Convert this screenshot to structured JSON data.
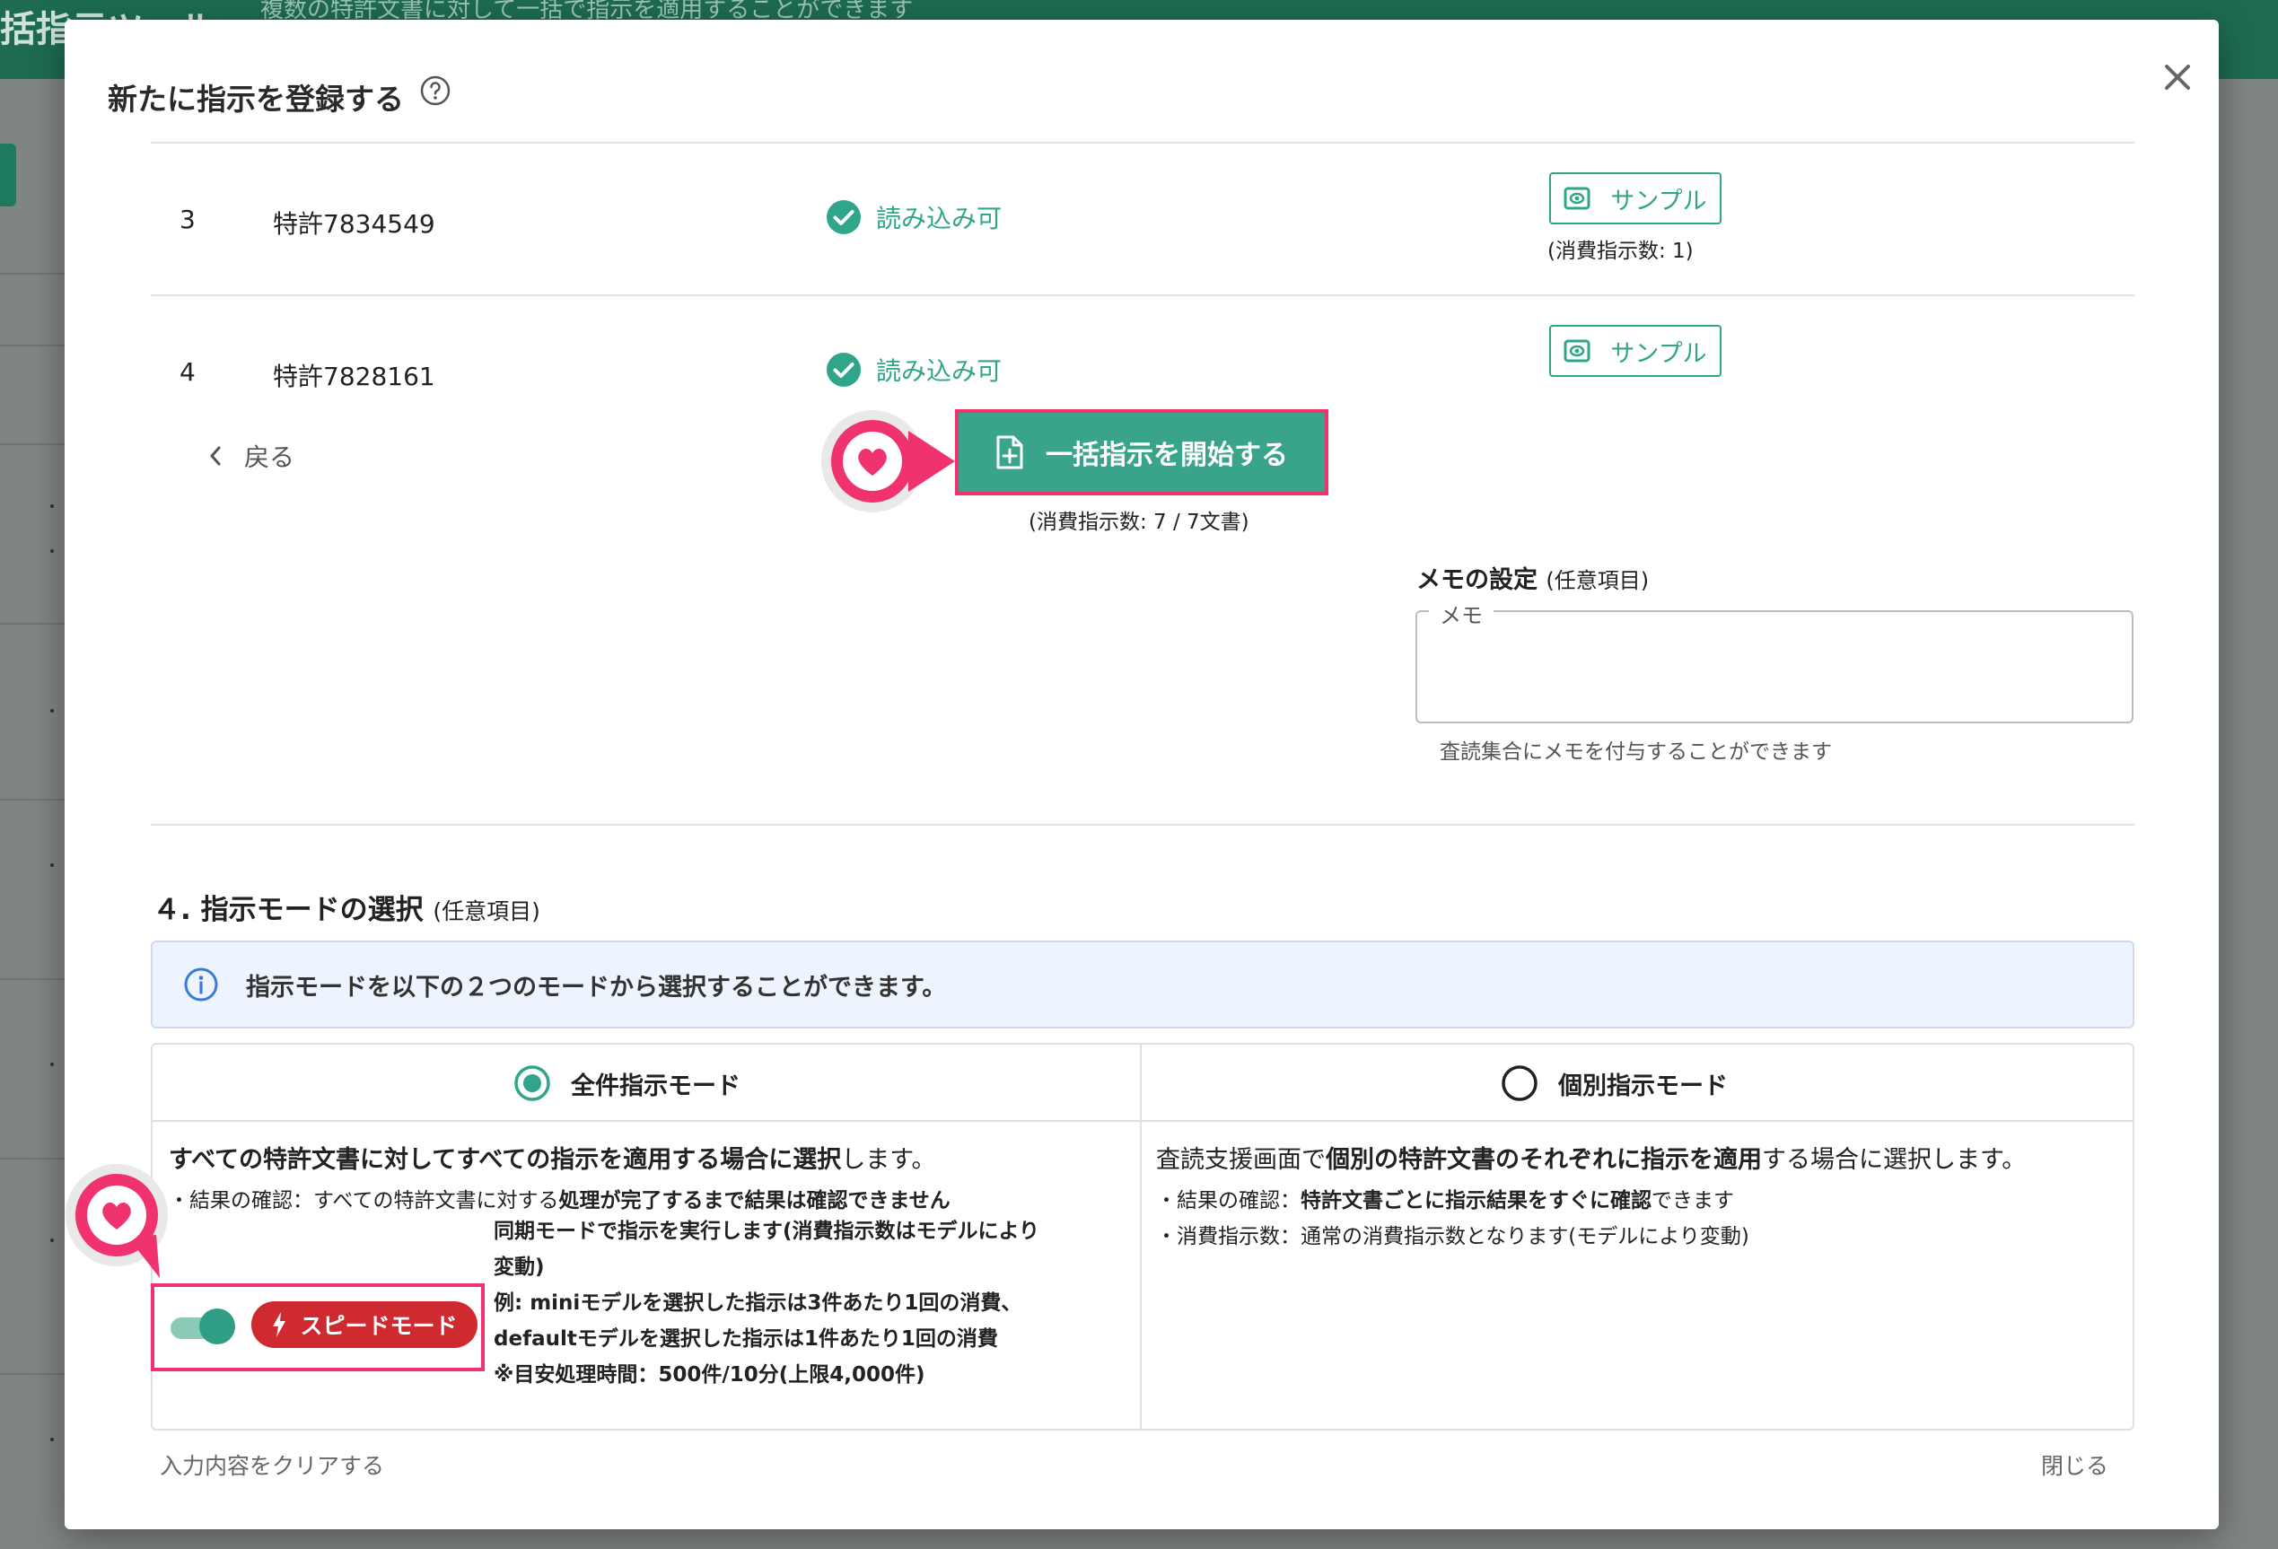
{
  "background": {
    "app_title": "括指示ツール",
    "subtitle": "複数の特許文書に対して一括で指示を適用することができます"
  },
  "modal": {
    "title": "新たに指示を登録する"
  },
  "documents": [
    {
      "index": "3",
      "name": "特許7834549",
      "status": "読み込み可",
      "sample_label": "サンプル",
      "consume": "(消費指示数: 1)"
    },
    {
      "index": "4",
      "name": "特許7828161",
      "status": "読み込み可",
      "sample_label": "サンプル"
    }
  ],
  "actions": {
    "back_label": "戻る",
    "start_label": "一括指示を開始する",
    "start_consume": "(消費指示数: 7 / 7文書)"
  },
  "memo": {
    "title": "メモの設定",
    "optional": "(任意項目)",
    "legend": "メモ",
    "value": "",
    "help": "査読集合にメモを付与することができます"
  },
  "mode_section": {
    "title": "４. 指示モードの選択",
    "optional": "(任意項目)",
    "info": "指示モードを以下の２つのモードから選択することができます。",
    "modes": [
      {
        "label": "全件指示モード",
        "selected": true,
        "desc_pre": "すべての特許文書に対してすべての指示を適用する場合に選択",
        "desc_post": "します。",
        "sub_pre": "・結果の確認：すべての特許文書に対する",
        "sub_bold": "処理が完了するまで結果は確認できません"
      },
      {
        "label": "個別指示モード",
        "selected": false,
        "desc_pre": "査読支援画面で",
        "desc_bold": "個別の特許文書のそれぞれに指示を適用",
        "desc_post": "する場合に選択します。",
        "sub1_pre": "・結果の確認：",
        "sub1_bold": "特許文書ごとに指示結果をすぐに確認",
        "sub1_post": "できます",
        "sub2": "・消費指示数：通常の消費指示数となります(モデルにより変動)"
      }
    ],
    "speed": {
      "label": "スピードモード",
      "enabled": true,
      "notes": [
        "同期モードで指示を実行します(消費指示数はモデルにより",
        "変動)",
        "例: miniモデルを選択した指示は3件あたり1回の消費、",
        "defaultモデルを選択した指示は1件あたり1回の消費",
        "※目安処理時間：500件/10分(上限4,000件)"
      ]
    }
  },
  "footer": {
    "clear_label": "入力内容をクリアする",
    "close_label": "閉じる"
  },
  "colors": {
    "accent": "#2fa58a",
    "button_bg": "#3aa48a",
    "highlight": "#f0336f",
    "speed_badge": "#cf2a2f",
    "header": "#1e6b52"
  }
}
